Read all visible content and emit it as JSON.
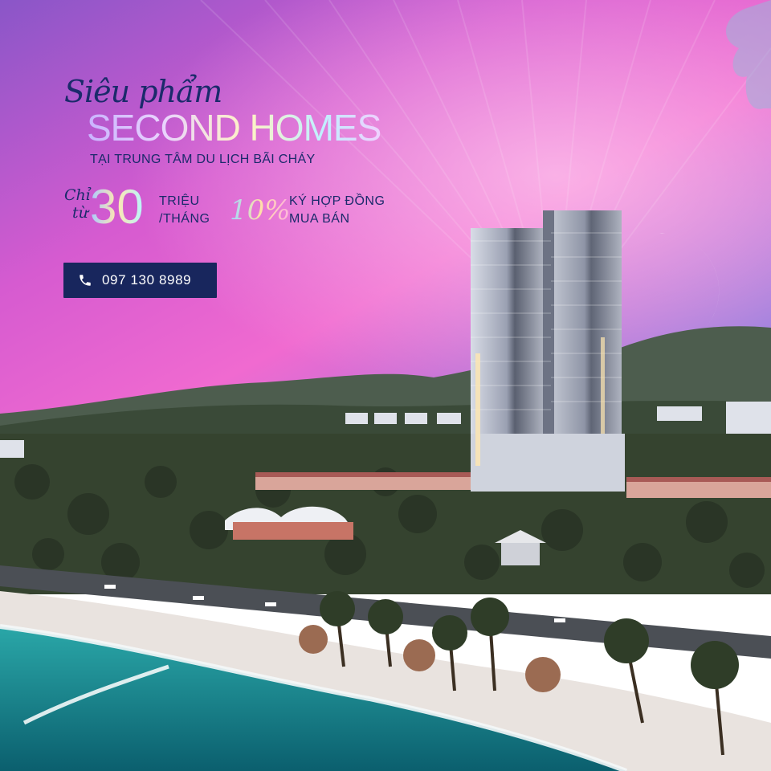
{
  "headline": {
    "script_line": "Siêu phẩm",
    "title": "SECOND HOMES",
    "subtitle": "TẠI TRUNG TÂM DU LỊCH BÃI CHÁY"
  },
  "offer": {
    "from_label_1": "Chỉ",
    "from_label_2": "từ",
    "amount": "30",
    "unit_1": "TRIỆU",
    "unit_2": "/THÁNG",
    "percent": "10%",
    "percent_label_1": "KÝ HỢP ĐỒNG",
    "percent_label_2": "MUA BÁN"
  },
  "contact": {
    "phone_icon": "phone-icon",
    "phone": "097 130 8989"
  },
  "colors": {
    "navy": "#1b2a6b",
    "button_bg": "#18265d",
    "sky_top": "#b04fc8",
    "sky_bottom": "#f06cd2",
    "sea": "#0e7a86"
  }
}
